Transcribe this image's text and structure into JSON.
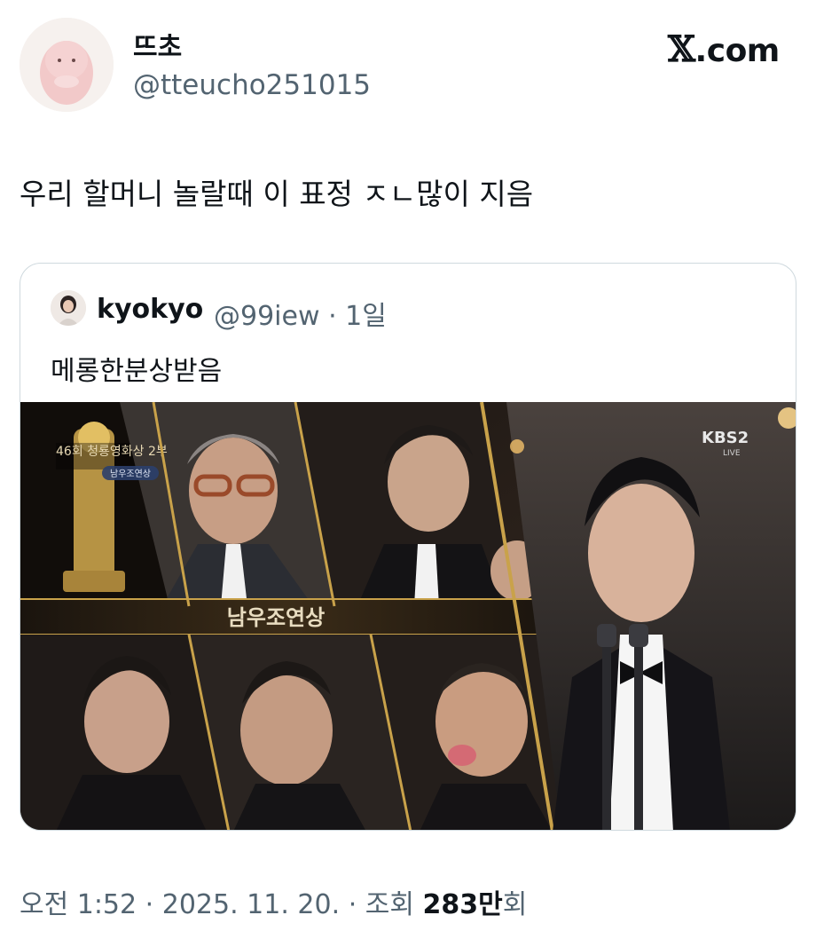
{
  "author": {
    "display_name": "뜨초",
    "handle": "@tteucho251015"
  },
  "brand": {
    "x_mark": "𝕏",
    "domain": ".com"
  },
  "tweet": {
    "text": "우리 할머니 놀랄때 이 표정 ㅈㄴ많이 지음"
  },
  "quoted": {
    "display_name": "kyokyo",
    "handle": "@99iew",
    "separator": "·",
    "time": "1일",
    "text": "메롱한분상받음",
    "media": {
      "banner_text": "남우조연상",
      "event_badge": "46회 청룡영화상 2부",
      "badge_caption": "남우조연상",
      "broadcaster": "KBS2",
      "broadcast_status": "LIVE"
    }
  },
  "meta": {
    "time": "오전 1:52",
    "sep1": "·",
    "date": "2025. 11. 20.",
    "sep2": "·",
    "views_label": "조회",
    "views_count": "283만",
    "views_suffix": "회"
  },
  "colors": {
    "text_primary": "#0f1419",
    "text_secondary": "#536471",
    "border": "#cfd9de",
    "gold": "#c9a24a"
  }
}
